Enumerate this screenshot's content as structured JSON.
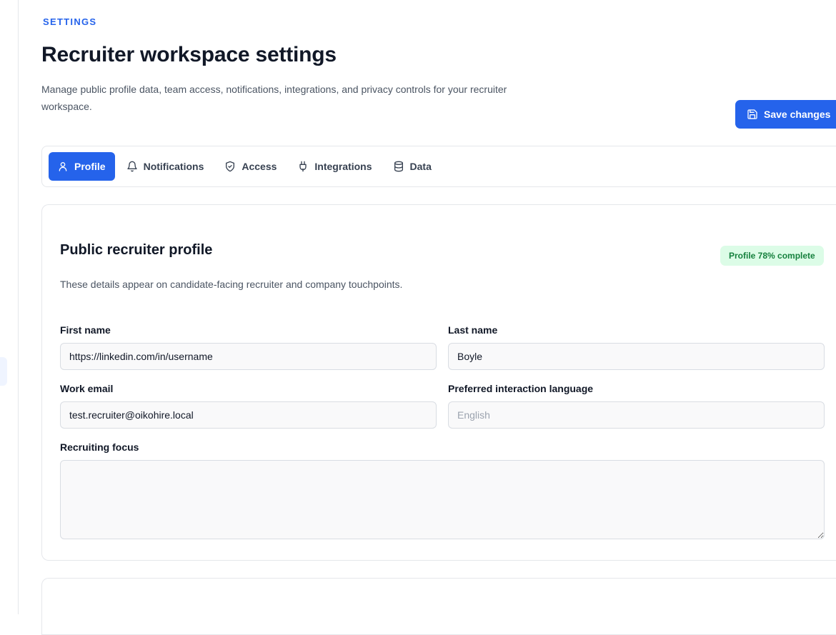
{
  "header": {
    "eyebrow": "SETTINGS",
    "title": "Recruiter workspace settings",
    "description": "Manage public profile data, team access, notifications, integrations, and privacy controls for your recruiter workspace.",
    "save_label": "Save changes"
  },
  "tabs": [
    {
      "label": "Profile",
      "icon": "user-icon",
      "active": true
    },
    {
      "label": "Notifications",
      "icon": "bell-icon",
      "active": false
    },
    {
      "label": "Access",
      "icon": "shield-icon",
      "active": false
    },
    {
      "label": "Integrations",
      "icon": "plug-icon",
      "active": false
    },
    {
      "label": "Data",
      "icon": "database-icon",
      "active": false
    }
  ],
  "profile": {
    "title": "Public recruiter profile",
    "badge": "Profile 78% complete",
    "completion_percent": 78,
    "description": "These details appear on candidate-facing recruiter and company touchpoints.",
    "fields": {
      "first_name": {
        "label": "First name",
        "value": "https://linkedin.com/in/username"
      },
      "last_name": {
        "label": "Last name",
        "value": "Boyle"
      },
      "work_email": {
        "label": "Work email",
        "value": "test.recruiter@oikohire.local"
      },
      "language": {
        "label": "Preferred interaction language",
        "value": "English"
      },
      "recruiting_focus": {
        "label": "Recruiting focus",
        "value": ""
      }
    }
  },
  "colors": {
    "accent": "#2563eb",
    "badge_bg": "#dcfce7",
    "badge_text": "#15803d",
    "border": "#e5e7eb"
  }
}
